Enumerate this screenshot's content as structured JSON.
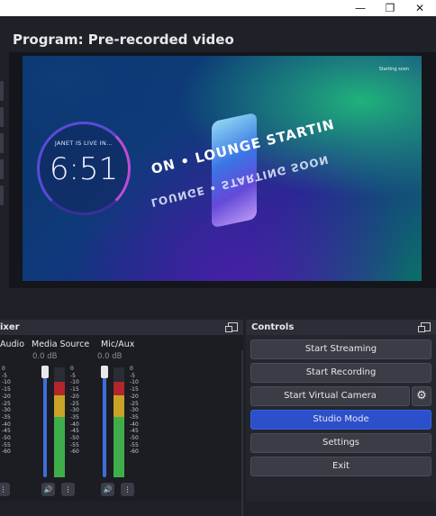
{
  "window": {
    "minimize": "—",
    "maximize": "❐",
    "close": "✕"
  },
  "program": {
    "title": "Program: Pre-recorded video"
  },
  "preview": {
    "starting_soon": "Starting soon",
    "timer_label": "JANET IS  LIVE IN...",
    "timer_value": "6:51",
    "ring_text_top": "ON • LOUNGE STARTIN",
    "ring_text_bottom": "LOUNGE • STARTING SOON"
  },
  "mixer": {
    "header": "ixer",
    "channels": [
      {
        "name": "Audio",
        "db": "",
        "ticks": [
          "0",
          "-5",
          "-10",
          "-15",
          "-20",
          "-25",
          "-30",
          "-35",
          "-40",
          "-45",
          "-50",
          "-55",
          "-60"
        ]
      },
      {
        "name": "Media Source",
        "db": "0.0 dB",
        "ticks": [
          "0",
          "-5",
          "-10",
          "-15",
          "-20",
          "-25",
          "-30",
          "-35",
          "-40",
          "-45",
          "-50",
          "-55",
          "-60"
        ]
      },
      {
        "name": "Mic/Aux",
        "db": "0.0 dB",
        "ticks": [
          "0",
          "-5",
          "-10",
          "-15",
          "-20",
          "-25",
          "-30",
          "-35",
          "-40",
          "-45",
          "-50",
          "-55",
          "-60"
        ]
      }
    ],
    "mute_icon": "🔊",
    "menu_icon": "⋮"
  },
  "controls": {
    "header": "Controls",
    "start_streaming": "Start Streaming",
    "start_recording": "Start Recording",
    "start_virtual_camera": "Start Virtual Camera",
    "studio_mode": "Studio Mode",
    "settings": "Settings",
    "exit": "Exit",
    "gear_icon": "⚙"
  },
  "colors": {
    "accent": "#2c4fcb",
    "background": "#1f2128"
  }
}
